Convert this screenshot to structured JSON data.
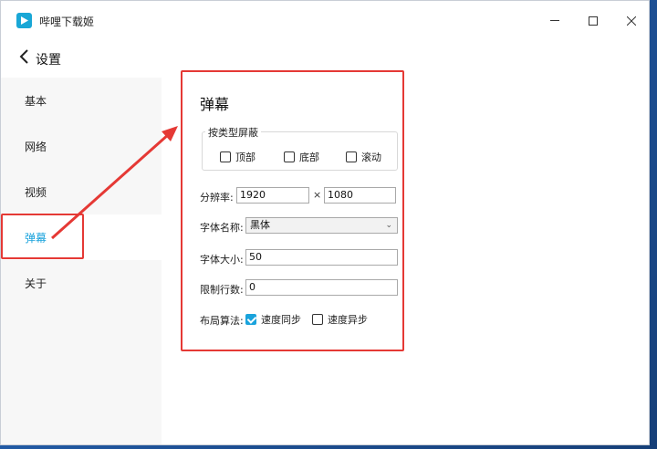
{
  "app": {
    "title": "哔哩下载姬"
  },
  "window_controls": {
    "minimize": "—",
    "maximize": "☐",
    "close": "✕"
  },
  "header": {
    "back_label": "设置"
  },
  "sidebar": {
    "items": [
      {
        "label": "基本"
      },
      {
        "label": "网络"
      },
      {
        "label": "视频"
      },
      {
        "label": "弹幕"
      },
      {
        "label": "关于"
      }
    ],
    "active_index": 3
  },
  "danmaku": {
    "title": "弹幕",
    "filter_group": {
      "legend": "按类型屏蔽",
      "options": [
        {
          "label": "顶部",
          "checked": false
        },
        {
          "label": "底部",
          "checked": false
        },
        {
          "label": "滚动",
          "checked": false
        }
      ]
    },
    "resolution": {
      "label": "分辨率:",
      "width": "1920",
      "separator": "×",
      "height": "1080"
    },
    "font_name": {
      "label": "字体名称:",
      "value": "黑体"
    },
    "font_size": {
      "label": "字体大小:",
      "value": "50"
    },
    "line_limit": {
      "label": "限制行数:",
      "value": "0"
    },
    "layout_algorithm": {
      "label": "布局算法:",
      "options": [
        {
          "label": "速度同步",
          "checked": true
        },
        {
          "label": "速度异步",
          "checked": false
        }
      ]
    }
  },
  "colors": {
    "accent": "#1aa3dc",
    "annotation": "#e53935"
  }
}
